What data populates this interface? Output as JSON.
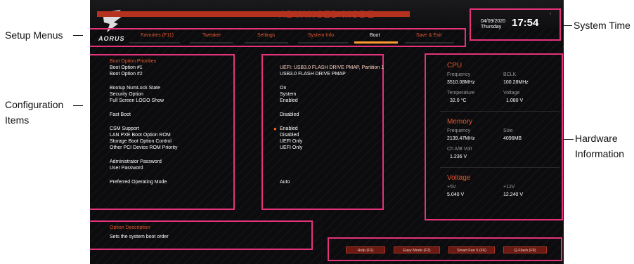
{
  "callouts": {
    "setup_menus": "Setup Menus",
    "configuration": "Configuration",
    "items": "Items",
    "system_time": "System Time",
    "hardware": "Hardware",
    "information": "Information"
  },
  "brand": {
    "logo_text": "AORUS"
  },
  "title": "ADVANCED MODE",
  "menus": [
    {
      "label": "Favorites (F11)"
    },
    {
      "label": "Tweaker"
    },
    {
      "label": "Settings"
    },
    {
      "label": "System Info."
    },
    {
      "label": "Boot",
      "active": true
    },
    {
      "label": "Save & Exit"
    }
  ],
  "system_time": {
    "date": "04/09/2020",
    "weekday": "Thursday",
    "time": "17:54"
  },
  "config": {
    "section_title": "Boot Option Priorities",
    "items": [
      {
        "label": "Boot Option #1",
        "value": "UEFI: USB3.0 FLASH DRIVE PMAP, Partition 1",
        "highlighted": true
      },
      {
        "label": "Boot Option #2",
        "value": "USB3.0 FLASH DRIVE PMAP"
      },
      {
        "label": "Bootup NumLock State",
        "value": "On"
      },
      {
        "label": "Security Option",
        "value": "System"
      },
      {
        "label": "Full Screen LOGO Show",
        "value": "Enabled"
      },
      {
        "label": "Fast Boot",
        "value": "Disabled"
      },
      {
        "label": "CSM Support",
        "value": "Enabled"
      },
      {
        "label": "LAN PXE Boot Option ROM",
        "value": "Disabled"
      },
      {
        "label": "Storage Boot Option Control",
        "value": "UEFI Only"
      },
      {
        "label": "Other PCI Device ROM Priority",
        "value": "UEFI Only"
      },
      {
        "label": "Administrator Password",
        "value": ""
      },
      {
        "label": "User Password",
        "value": ""
      },
      {
        "label": "Preferred Operating Mode",
        "value": "Auto"
      }
    ]
  },
  "hardware": {
    "cpu": {
      "title": "CPU",
      "frequency_label": "Frequency",
      "frequency": "3510.08MHz",
      "bclk_label": "BCLK",
      "bclk": "100.28MHz",
      "temp_label": "Temperature",
      "temp": "32.0 °C",
      "voltage_label": "Voltage",
      "voltage": "1.080 V"
    },
    "memory": {
      "title": "Memory",
      "frequency_label": "Frequency",
      "frequency": "2139.47MHz",
      "size_label": "Size",
      "size": "4096MB",
      "volt_label": "Ch A/B Volt",
      "volt": "1.236 V"
    },
    "voltage": {
      "title": "Voltage",
      "p5_label": "+5V",
      "p5": "5.040 V",
      "p12_label": "+12V",
      "p12": "12.240 V"
    }
  },
  "description": {
    "title": "Option Description",
    "text": "Sets the system boot order"
  },
  "function_buttons": [
    {
      "label": "Help (F1)"
    },
    {
      "label": "Easy Mode (F2)"
    },
    {
      "label": "Smart Fan 5 (F6)"
    },
    {
      "label": "Q-Flash (F8)"
    }
  ],
  "colors": {
    "highlight": "#e4337a",
    "accent": "#e2572e",
    "active_tab": "#ff9a2e"
  }
}
